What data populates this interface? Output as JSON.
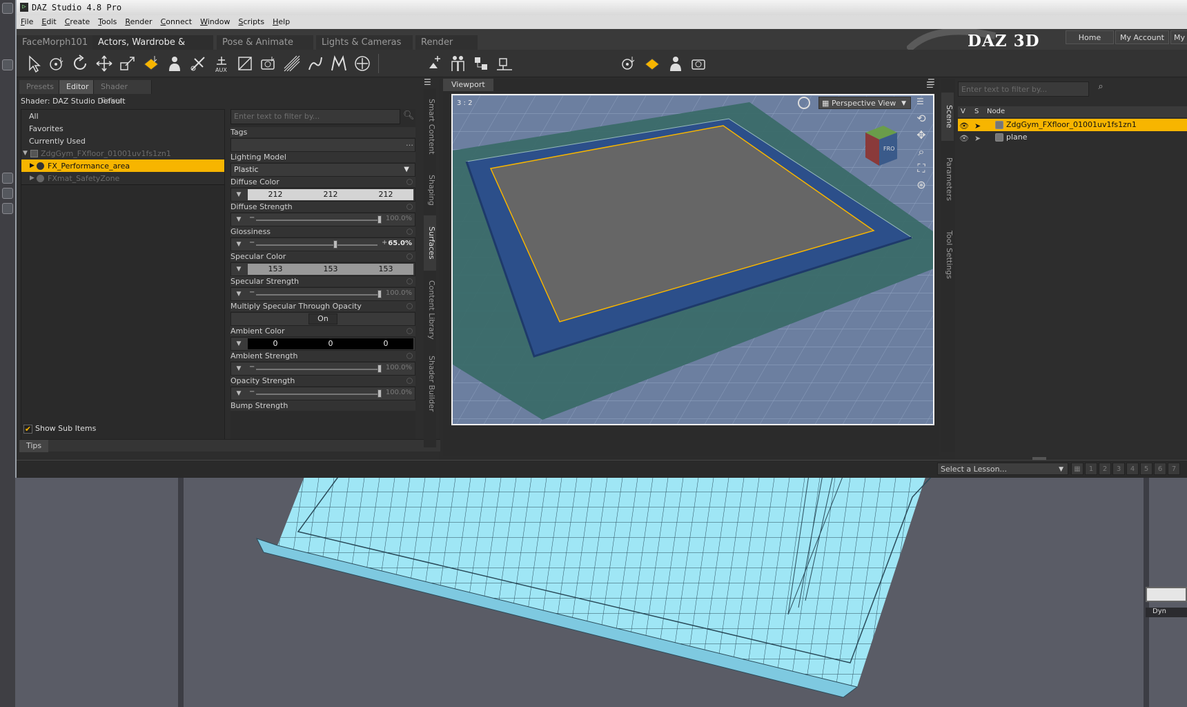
{
  "app": {
    "title": "DAZ Studio 4.8 Pro"
  },
  "menu": [
    "File",
    "Edit",
    "Create",
    "Tools",
    "Render",
    "Connect",
    "Window",
    "Scripts",
    "Help"
  ],
  "header": {
    "tabs": [
      "FaceMorph101",
      "Actors, Wardrobe & Props",
      "Pose & Animate",
      "Lights & Cameras",
      "Render"
    ],
    "logo": "DAZ 3D",
    "nav": [
      "Home",
      "My Account",
      "My C"
    ]
  },
  "left_panel": {
    "tabs": [
      "Presets",
      "Editor",
      "Shader Baker"
    ],
    "shader": "Shader: DAZ Studio Default",
    "tree": [
      {
        "label": "All"
      },
      {
        "label": "Favorites"
      },
      {
        "label": "Currently Used"
      },
      {
        "label": "ZdgGym_FXfloor_01001uv1fs1zn1"
      },
      {
        "label": "FX_Performance_area"
      },
      {
        "label": "FXmat_SafetyZone"
      }
    ],
    "show_sub_items": "Show Sub Items",
    "filter_placeholder": "Enter text to filter by...",
    "tags_label": "Tags",
    "properties": {
      "lighting_model": {
        "label": "Lighting Model",
        "value": "Plastic"
      },
      "diffuse_color": {
        "label": "Diffuse Color",
        "values": [
          "212",
          "212",
          "212"
        ]
      },
      "diffuse_strength": {
        "label": "Diffuse Strength",
        "value": "100.0%"
      },
      "glossiness": {
        "label": "Glossiness",
        "value": "65.0%"
      },
      "specular_color": {
        "label": "Specular Color",
        "values": [
          "153",
          "153",
          "153"
        ]
      },
      "specular_strength": {
        "label": "Specular Strength",
        "value": "100.0%"
      },
      "multiply_specular": {
        "label": "Multiply Specular Through Opacity",
        "value": "On"
      },
      "ambient_color": {
        "label": "Ambient Color",
        "values": [
          "0",
          "0",
          "0"
        ]
      },
      "ambient_strength": {
        "label": "Ambient Strength",
        "value": "100.0%"
      },
      "opacity_strength": {
        "label": "Opacity Strength",
        "value": "100.0%"
      },
      "bump_strength": {
        "label": "Bump Strength"
      }
    },
    "side_tabs": [
      "Smart Content",
      "Shaping",
      "Surfaces",
      "Content Library",
      "Shader Builder"
    ],
    "tips": "Tips"
  },
  "viewport": {
    "tab": "Viewport",
    "ratio": "3 : 2",
    "view": "Perspective View",
    "cube_label": "FRO"
  },
  "right_panel": {
    "side_tabs": [
      "Scene",
      "Parameters",
      "Tool Settings"
    ],
    "filter_placeholder": "Enter text to filter by...",
    "columns": {
      "v": "V",
      "s": "S",
      "node": "Node"
    },
    "nodes": [
      {
        "label": "ZdgGym_FXfloor_01001uv1fs1zn1"
      },
      {
        "label": "plane"
      }
    ]
  },
  "statusbar": {
    "lesson_placeholder": "Select a Lesson...",
    "pages": [
      "1",
      "2",
      "3",
      "4",
      "5",
      "6",
      "7"
    ]
  },
  "background": {
    "label": "Dyn"
  }
}
